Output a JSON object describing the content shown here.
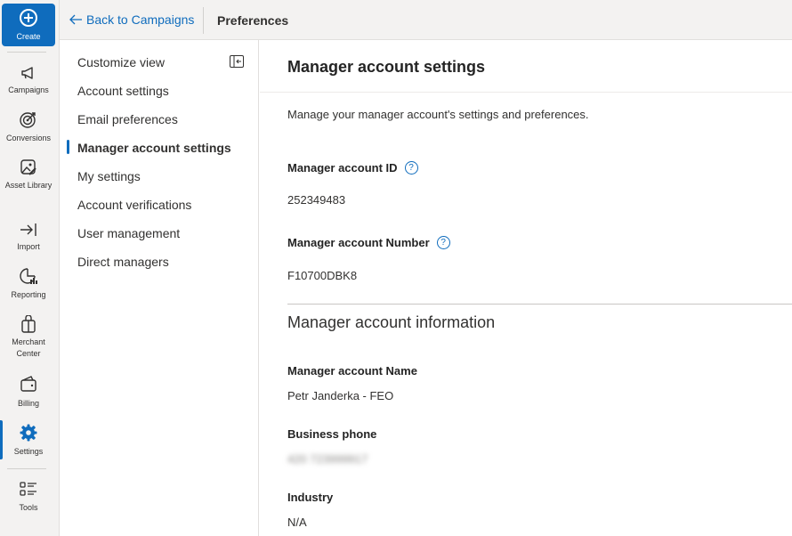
{
  "rail": {
    "create_label": "Create",
    "items": [
      {
        "label": "Campaigns",
        "icon": "megaphone-icon"
      },
      {
        "label": "Conversions",
        "icon": "target-icon"
      },
      {
        "label": "Asset Library",
        "icon": "image-edit-icon"
      },
      {
        "label": "Import",
        "icon": "import-arrow-icon"
      },
      {
        "label": "Reporting",
        "icon": "chart-icon"
      },
      {
        "label": "Merchant Center",
        "icon": "shopping-bag-icon"
      },
      {
        "label": "Billing",
        "icon": "wallet-icon"
      },
      {
        "label": "Settings",
        "icon": "gear-icon"
      },
      {
        "label": "Tools",
        "icon": "tools-list-icon"
      }
    ],
    "active": "Settings",
    "accent_color": "#0f6cbd"
  },
  "topbar": {
    "back_label": "Back to Campaigns",
    "title": "Preferences"
  },
  "subnav": {
    "items": [
      "Customize view",
      "Account settings",
      "Email preferences",
      "Manager account settings",
      "My settings",
      "Account verifications",
      "User management",
      "Direct managers"
    ],
    "active": "Manager account settings"
  },
  "main": {
    "title": "Manager account settings",
    "description": "Manage your manager account's settings and preferences.",
    "manager_id_label": "Manager account ID",
    "manager_id_value": "252349483",
    "manager_number_label": "Manager account Number",
    "manager_number_value": "F10700DBK8",
    "info_section_title": "Manager account information",
    "name_label": "Manager account Name",
    "name_value": "Petr Janderka - FEO",
    "phone_label": "Business phone",
    "phone_value": "420 723999917",
    "industry_label": "Industry",
    "industry_value": "N/A",
    "help_glyph": "?"
  }
}
